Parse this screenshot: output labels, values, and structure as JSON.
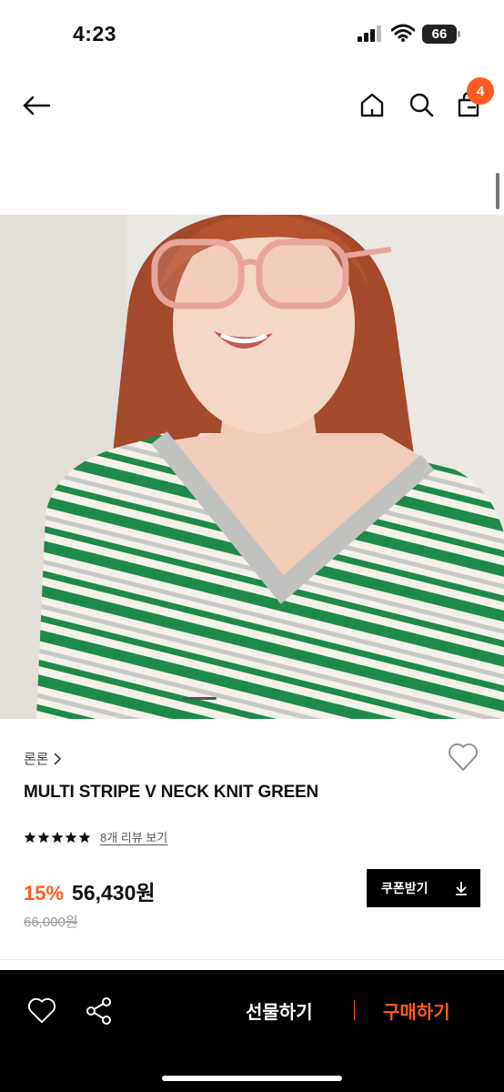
{
  "status_bar": {
    "time": "4:23",
    "battery": "66"
  },
  "header": {
    "cart_count": "4"
  },
  "icons": {
    "back": "arrow-left-icon",
    "home": "home-icon",
    "search": "search-icon",
    "bag": "shopping-bag-icon",
    "wishlist": "heart-icon",
    "share": "share-icon",
    "download": "download-icon"
  },
  "product": {
    "brand": "론론",
    "title": "MULTI STRIPE V NECK KNIT GREEN",
    "rating_stars": 5,
    "review_link": "8개 리뷰 보기",
    "discount": "15%",
    "price": "56,430원",
    "original_price": "66,000원",
    "coupon_label": "쿠폰받기"
  },
  "bottom_bar": {
    "gift_label": "선물하기",
    "buy_label": "구매하기"
  },
  "colors": {
    "accent": "#ff5a1f",
    "bar_background": "#000000",
    "knit_green": "#1e8a4a"
  }
}
